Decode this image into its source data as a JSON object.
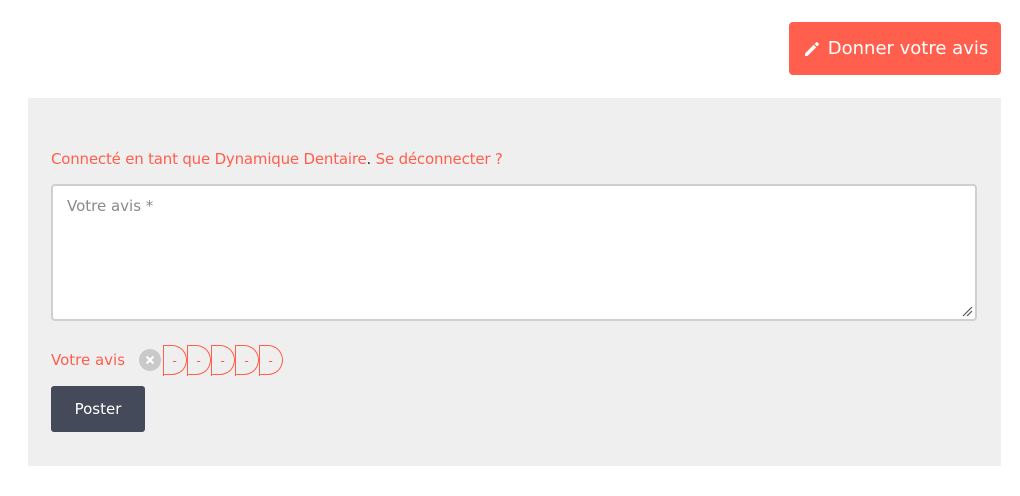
{
  "header": {
    "give_review_label": "Donner votre avis"
  },
  "form": {
    "logged_in_text": "Connecté en tant que Dynamique Dentaire",
    "separator": ".",
    "logout_text": "Se déconnecter ?",
    "textarea_placeholder": "Votre avis *",
    "rating_label": "Votre avis",
    "star_glyph": "-",
    "submit_label": "Poster"
  },
  "colors": {
    "accent": "#ff5f4c",
    "panel_bg": "#efefef",
    "button_dark": "#444a59"
  },
  "icons": {
    "give_review": "pencil-icon",
    "cancel_rating": "cancel-rating-icon",
    "star": "star-outline-icon"
  }
}
